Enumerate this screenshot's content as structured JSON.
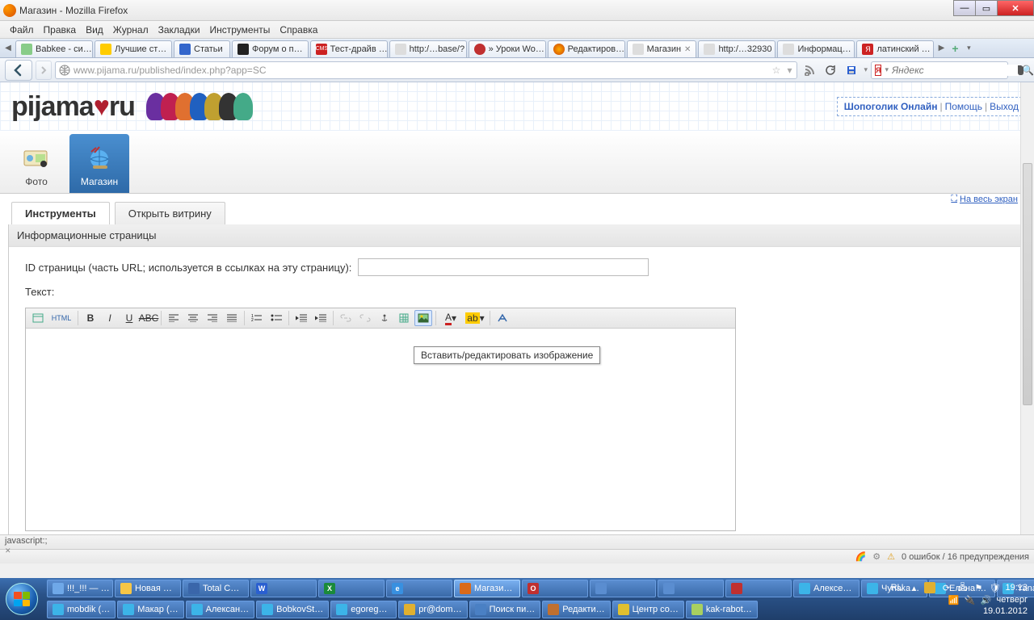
{
  "window": {
    "title": "Магазин - Mozilla Firefox"
  },
  "menu": [
    "Файл",
    "Правка",
    "Вид",
    "Журнал",
    "Закладки",
    "Инструменты",
    "Справка"
  ],
  "tabs": [
    {
      "label": "Babkee - си…",
      "active": false
    },
    {
      "label": "Лучшие ст…",
      "active": false
    },
    {
      "label": "Статьи",
      "active": false
    },
    {
      "label": "Форум о п…",
      "active": false
    },
    {
      "label": "Тест-драйв …",
      "active": false
    },
    {
      "label": "http:/…base/?",
      "active": false
    },
    {
      "label": "» Уроки Wo…",
      "active": false
    },
    {
      "label": "Редактиров…",
      "active": false
    },
    {
      "label": "Магазин",
      "active": true
    },
    {
      "label": "http:/…32930",
      "active": false
    },
    {
      "label": "Информац…",
      "active": false
    },
    {
      "label": "латинский …",
      "active": false
    }
  ],
  "url": {
    "host": "www.pijama.ru/",
    "path": "published/index.php?app=SC"
  },
  "search": {
    "placeholder": "Яндекс"
  },
  "header_links": {
    "user": "Шопоголик Онлайн",
    "help": "Помощь",
    "logout": "Выход"
  },
  "appnav": {
    "photo": "Фото",
    "shop": "Магазин"
  },
  "content_tabs": {
    "tools": "Инструменты",
    "open": "Открыть витрину",
    "fullscreen": "На весь экран"
  },
  "panel": {
    "title": "Информационные страницы",
    "id_label": "ID страницы (часть URL; используется в ссылках на эту страницу):",
    "text_label": "Текст:"
  },
  "tooltip": "Вставить/редактировать изображение",
  "status1": "javascript:;",
  "status2": "0 ошибок / 16 предупреждения",
  "taskbar": {
    "row1": [
      {
        "label": "!!!_!!! — …",
        "color": "#6fa8e8"
      },
      {
        "label": "Новая …",
        "color": "#f6c647"
      },
      {
        "label": "Total C…",
        "color": "#3a66aa"
      },
      {
        "label": "",
        "color": "#2a5fd0",
        "icon": "W"
      },
      {
        "label": "",
        "color": "#1a8a3a",
        "icon": "X"
      },
      {
        "label": "",
        "color": "#3890e0",
        "icon": "e"
      },
      {
        "label": "Магази…",
        "color": "#d96a1a",
        "active": true
      },
      {
        "label": "",
        "color": "#c03030",
        "icon": "O"
      },
      {
        "label": "",
        "color": "#5a8dd0"
      },
      {
        "label": "",
        "color": "#5a8dd0"
      },
      {
        "label": "",
        "color": "#c03030"
      },
      {
        "label": "Алексе…",
        "color": "#3cb4e8"
      },
      {
        "label": "Чупака…",
        "color": "#3cb4e8"
      },
      {
        "label": "Елена …",
        "color": "#3cb4e8"
      },
      {
        "label": "Yana (Я…",
        "color": "#3cb4e8"
      }
    ],
    "row2": [
      {
        "label": "mobdik (…",
        "color": "#3cb4e8"
      },
      {
        "label": "Макар (…",
        "color": "#3cb4e8"
      },
      {
        "label": "Алексан…",
        "color": "#3cb4e8"
      },
      {
        "label": "BobkovSt…",
        "color": "#3cb4e8"
      },
      {
        "label": "egoreg…",
        "color": "#3cb4e8"
      },
      {
        "label": "pr@dom…",
        "color": "#e0b030"
      },
      {
        "label": "Поиск пи…",
        "color": "#4a80c4"
      },
      {
        "label": "Редакти…",
        "color": "#c07030"
      },
      {
        "label": "Центр со…",
        "color": "#e0c030"
      },
      {
        "label": "kak-rabot…",
        "color": "#a8d060"
      }
    ],
    "lang": "RU",
    "time": "19:13",
    "day": "четверг",
    "date": "19.01.2012"
  }
}
